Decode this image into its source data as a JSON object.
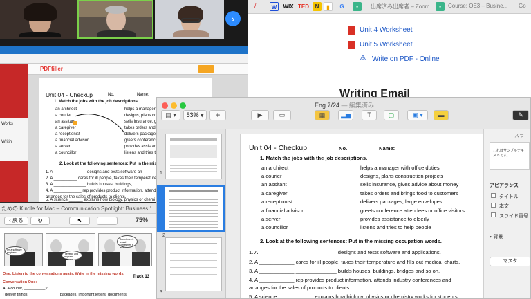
{
  "browser": {
    "tabs": [
      {
        "icon": "W",
        "color": "#1d4ed8"
      },
      {
        "icon": "WIX",
        "color": "#111"
      },
      {
        "icon": "TED",
        "color": "#e62b1e"
      },
      {
        "icon": "N",
        "color": "#f5c400"
      },
      {
        "icon": "G",
        "color": "#4285f4"
      }
    ],
    "tab_title_zoom": "出席済み出席者 – Zoom",
    "tab_title_course": "Course: OE3 – Busine...",
    "tab_title_go": "Go",
    "links": [
      "Unit 4 Worksheet",
      "Unit 5 Worksheet",
      "Write on PDF - Online"
    ],
    "heading": "Writing Email"
  },
  "zoom": {
    "next_label": "›"
  },
  "editor": {
    "app": "PDFfiller",
    "title": "Unit 04 - Checkup",
    "no_label": "No.",
    "name_label": "Name:",
    "task1": "1.   Match the jobs with the job descriptions.",
    "jobs": [
      "an architect",
      "a courier",
      "an assitant",
      "a caregiver",
      "a receptionist",
      "a financial advisor",
      "a server",
      "a councillor"
    ],
    "descs": [
      "helps a manager wi",
      "designs, plans cons",
      "sells insurance, giv",
      "takes orders and bi",
      "delivers packages,",
      "greets conference a",
      "provides assistance",
      "listens and tries to h"
    ],
    "task2": "2.   Look at the following sentences:  Put in the missing",
    "sentences": [
      "1.  A ______________ designs and tests software an",
      "2.  A __________ cares for ill people, takes their temperature and",
      "3.  A ______________ builds houses, buildings,",
      "4.  A ____________ rep provides product information, attends indu",
      "     arranges for the sales of products to clients.",
      "5.  A  science  ______ explains how biology, physics or chemi"
    ]
  },
  "kindle": {
    "title": "ための Kindle for Mac – Communication Spotlight: Business 1",
    "back_label": "戻る",
    "zoom_level": "75%",
    "exercise": "One: Listen to the conversations again. Write in the missing words.",
    "track": "Track 13",
    "conv": "Conversation One:",
    "line_a": "A:  A courier, __________?",
    "line_b": "I deliver things, ______________ packages, important letters, documents",
    "bubble1": "I'm a software engineer.",
    "bubble2": "I develop and program software.",
    "bubble3": "Sometimes it is and sometimes it isn't."
  },
  "preview": {
    "doc_title": "Eng 7/24",
    "doc_status": "— 編集済み",
    "zoom": "53%",
    "page_title": "Unit 04 - Checkup",
    "no_label": "No.",
    "name_label": "Name:",
    "task1": "1.   Match the jobs with the job descriptions.",
    "jobs": [
      "an architect",
      "a courier",
      "an assitant",
      "a caregiver",
      "a receptionist",
      "a financial advisor",
      "a server",
      "a councillor"
    ],
    "descs": [
      "helps a manager with office duties",
      "designs, plans construction projects",
      "sells insurance, gives advice about money",
      "takes orders and brings food to customers",
      "delivers packages, large envelopes",
      "greets conference attendees or office visitors",
      "provides assistance to elderly",
      "listens and tries to help people"
    ],
    "task2": "2.     Look at the following sentences:  Put in the missing occupation words.",
    "sentences": [
      "1.  A ____________  ______________  designs and tests software and applications.",
      "2.  A ____________  cares for ill people, takes their temperature and fills out medical charts.",
      "3.  A ____________  ______________  builds houses, buildings, bridges and so on.",
      "4.  A ____________  rep provides product information, attends industry conferences and",
      "     arranges for the sales of products to clients.",
      "5.  A  science  ____________  explains how biology, physics or chemistry works for students."
    ],
    "thumb_numbers": [
      "1",
      "2",
      "3"
    ],
    "side_tab": "スラ",
    "side_note": "これはサンプルテキストです。",
    "appearance": "アピアランス",
    "opts": [
      "タイトル",
      "本文",
      "スライド番号"
    ],
    "background": "背景",
    "master": "マスタ"
  }
}
